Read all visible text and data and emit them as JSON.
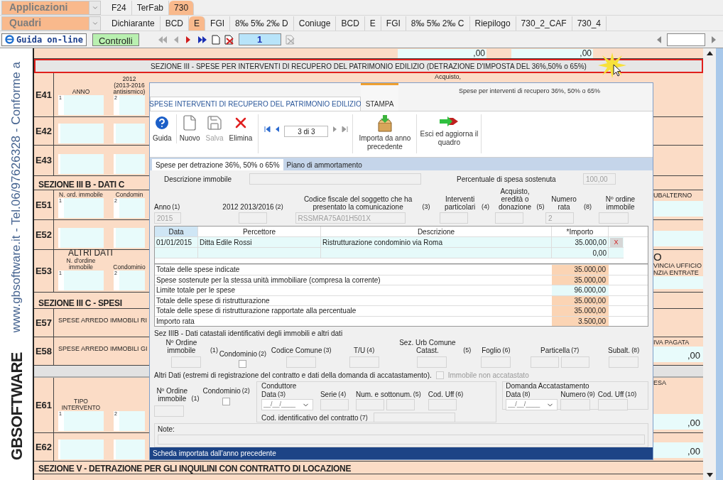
{
  "menu": {
    "applications": "Applicazioni",
    "app_tabs": [
      {
        "label": "F24",
        "selected": false
      },
      {
        "label": "TerFab",
        "selected": false
      },
      {
        "label": "730",
        "selected": true
      }
    ],
    "quadri": "Quadri",
    "quadri_tabs": [
      {
        "label": "Dichiarante",
        "selected": false
      },
      {
        "label": "BCD",
        "selected": false
      },
      {
        "label": "E",
        "selected": true
      },
      {
        "label": "FGI",
        "selected": false
      },
      {
        "label": "8‰ 5‰ 2‰ D",
        "selected": false
      },
      {
        "label": "Coniuge",
        "selected": false
      },
      {
        "label": "BCD",
        "selected": false
      },
      {
        "label": "E",
        "selected": false
      },
      {
        "label": "FGI",
        "selected": false
      },
      {
        "label": "8‰ 5‰ 2‰ C",
        "selected": false
      },
      {
        "label": "Riepilogo",
        "selected": false
      },
      {
        "label": "730_2_CAF",
        "selected": false
      },
      {
        "label": "730_4",
        "selected": false
      }
    ],
    "help_button": "Guida on-line",
    "checks_button": "Controlli",
    "page": "1"
  },
  "sidebar": {
    "contact": "www.gbsoftware.it - Tel.06/97626328 - Conforme a",
    "logo": "GBSOFTWARE"
  },
  "form": {
    "top_values": [
      ",00",
      ",00"
    ],
    "section_header": "SEZIONE III - SPESE PER INTERVENTI DI RECUPERO DEL PATRIMONIO EDILIZIO (DETRAZIONE D'IMPOSTA DEL 36%,50% o 65%)",
    "rows": [
      {
        "kind": "fields",
        "code": "E41",
        "labels": [
          "ANNO",
          "2012 (2013-2016 antisismico)"
        ],
        "numbers": [
          "1",
          "2"
        ],
        "middle": "Acquisto,"
      },
      {
        "kind": "fields",
        "code": "E42"
      },
      {
        "kind": "fields",
        "code": "E43"
      },
      {
        "kind": "section",
        "title": "SEZIONE III B - DATI C"
      },
      {
        "kind": "fields",
        "code": "E51",
        "labels": [
          "N. ord. immobile",
          "Condomin"
        ],
        "numbers": [
          "1",
          "2"
        ],
        "right": {
          "lines": [
            "UBALTERNO"
          ]
        }
      },
      {
        "kind": "fields",
        "code": "E52",
        "right": {}
      },
      {
        "kind": "fields",
        "code": "E53",
        "title": "ALTRI DATI",
        "labels": [
          "N. d'ordine immobile",
          "Condominio"
        ],
        "numbers": [
          "1",
          "2"
        ],
        "right": {
          "title": "O",
          "lines": [
            "VINCIA UFFICIO",
            "NZIA ENTRATE"
          ]
        }
      },
      {
        "kind": "section",
        "title": "SEZIONE III C - SPESI"
      },
      {
        "kind": "text",
        "code": "E57",
        "text": "SPESE ARREDO IMMOBILI RI"
      },
      {
        "kind": "text",
        "code": "E58",
        "text": "SPESE ARREDO IMMOBILI GI",
        "right": {
          "lines": [
            "IVA PAGATA"
          ],
          "value": ",00"
        }
      },
      {
        "kind": "spacer"
      },
      {
        "kind": "fields",
        "code": "E61",
        "labels": [
          "TIPO INTERVENTO"
        ],
        "numbers": [
          "1",
          "2"
        ],
        "right": {
          "lines": [
            "ESA"
          ],
          "value": ",00"
        }
      },
      {
        "kind": "fields",
        "code": "E62",
        "right": {
          "value": ",00"
        }
      },
      {
        "kind": "section",
        "title": "SEZIONE V - DETRAZIONE PER GLI INQUILINI CON CONTRATTO DI LOCAZIONE"
      }
    ]
  },
  "dialog": {
    "caption": "Spese per interventi di recupero 36%, 50% o 65%",
    "tabs": [
      {
        "label": "SPESE INTERVENTI DI RECUPERO DEL PATRIMONIO EDILIZIO",
        "selected": true
      },
      {
        "label": "STAMPA",
        "selected": false
      }
    ],
    "tools": [
      {
        "kind": "help",
        "label": "Guida",
        "disabled": false
      },
      {
        "kind": "new",
        "label": "Nuovo",
        "disabled": false
      },
      {
        "kind": "save",
        "label": "Salva",
        "disabled": true
      },
      {
        "kind": "delete",
        "label": "Elimina",
        "disabled": false
      }
    ],
    "record": "3 di 3",
    "actions": [
      {
        "kind": "import",
        "label": "Importa da anno precedente"
      },
      {
        "kind": "exit",
        "label": "Esci ed aggiorna il quadro"
      }
    ],
    "subtabs": [
      {
        "label": "Spese per detrazione 36%, 50% o 65%",
        "selected": true
      },
      {
        "label": "Piano di ammortamento",
        "selected": false
      }
    ],
    "description": {
      "label": "Descrizione immobile"
    },
    "percent": {
      "label": "Percentuale di spesa sostenuta",
      "value": "100,00"
    },
    "fields": [
      {
        "label": "Anno",
        "note": "(1)",
        "value": "2015"
      },
      {
        "label": "2012 2013/2016",
        "note": "(2)"
      },
      {
        "label": "Codice fiscale del soggetto che ha presentato la comunicazione",
        "note": "(3)",
        "value": "RSSMRA75A01H501X"
      },
      {
        "label": "Interventi particolari",
        "note": "(4)"
      },
      {
        "label": "Acquisto, eredità o donazione",
        "note": "(5)"
      },
      {
        "label": "Numero rata",
        "note": "(8)",
        "value": "2"
      },
      {
        "label": "Nº ordine immobile"
      }
    ],
    "table": {
      "columns": [
        {
          "label": "Data",
          "selected": true
        },
        {
          "label": "Percettore",
          "selected": false
        },
        {
          "label": "Descrizione",
          "selected": false
        },
        {
          "label": "*Importo",
          "selected": false
        }
      ],
      "rows": [
        {
          "cells": [
            "01/01/2015",
            "Ditta Edile Rossi",
            "Ristrutturazione condominio via Roma",
            "35.000,00"
          ],
          "delete": "X"
        },
        {
          "cells": [
            null,
            null,
            null,
            "0,00"
          ]
        }
      ]
    },
    "totals": [
      {
        "label": "Totale delle spese indicate",
        "value": "35.000,00",
        "kind": "calculated"
      },
      {
        "label": "Spese sostenute per la stessa unità immobiliare (compresa la corrente)",
        "value": "35.000,00",
        "kind": "calculated"
      },
      {
        "label": "Limite totale per le spese",
        "value": "96.000,00",
        "kind": "limit"
      },
      {
        "label": "Totale delle spese di ristrutturazione",
        "value": "35.000,00",
        "kind": "calculated"
      },
      {
        "label": "Totale delle spese di ristrutturazione rapportate alla percentuale",
        "value": "35.000,00",
        "kind": "calculated"
      },
      {
        "label": "Importo rata",
        "value": "3.500,00",
        "kind": "calculated"
      }
    ],
    "cadastral": {
      "title": "Sez IIIB - Dati catastali identificativi degli immobili e altri dati",
      "fields": [
        {
          "label": "Nº Ordine immobile",
          "note": "(1)",
          "kind": "text"
        },
        {
          "label": "Condominio",
          "note": "(2)",
          "kind": "checkbox",
          "checked": false
        },
        {
          "label": "Codice Comune",
          "note": "(3)",
          "kind": "text"
        },
        {
          "label": "T/U",
          "note": "(4)",
          "kind": "text"
        },
        {
          "label": "Sez. Urb Comune Catast.",
          "note": "(5)",
          "kind": "text"
        },
        {
          "label": "Foglio",
          "note": "(6)",
          "kind": "text"
        },
        {
          "label": "Particella",
          "note": "(7)",
          "kind": "double"
        },
        {
          "label": "Subalt.",
          "note": "(8)",
          "kind": "text"
        }
      ]
    },
    "other": {
      "title": "Altri Dati (estremi di registrazione del contratto e dati della domanda di accatastamento).",
      "unregistered": {
        "label": "Immobile non accatastato",
        "checked": false,
        "disabled": true
      },
      "fields": [
        {
          "label": "Nº Ordine immobile",
          "note": "(1)",
          "kind": "text"
        },
        {
          "label": "Condominio",
          "note": "(2)",
          "kind": "checkbox",
          "checked": false
        }
      ],
      "tenant": {
        "title": "Conduttore",
        "fields": [
          {
            "label": "Data",
            "note": "(3)",
            "kind": "date",
            "placeholder": "__/__/____"
          },
          {
            "label": "Serie",
            "note": "(4)",
            "kind": "text"
          },
          {
            "label": "Num. e sottonum.",
            "note": "(5)",
            "kind": "double"
          },
          {
            "label": "Cod. Uff",
            "note": "(6)",
            "kind": "text"
          }
        ],
        "contract": {
          "label": "Cod. identificativo del contratto",
          "note": "(7)"
        }
      },
      "registration": {
        "title": "Domanda Accatastamento",
        "fields": [
          {
            "label": "Data",
            "note": "(8)",
            "kind": "date",
            "placeholder": "__/__/____"
          },
          {
            "label": "Numero",
            "note": "(9)",
            "kind": "text"
          },
          {
            "label": "Cod. Uff",
            "note": "(10)",
            "kind": "text"
          }
        ]
      }
    },
    "note": {
      "label": "Note:"
    },
    "status": "Scheda importata dall'anno precedente"
  }
}
